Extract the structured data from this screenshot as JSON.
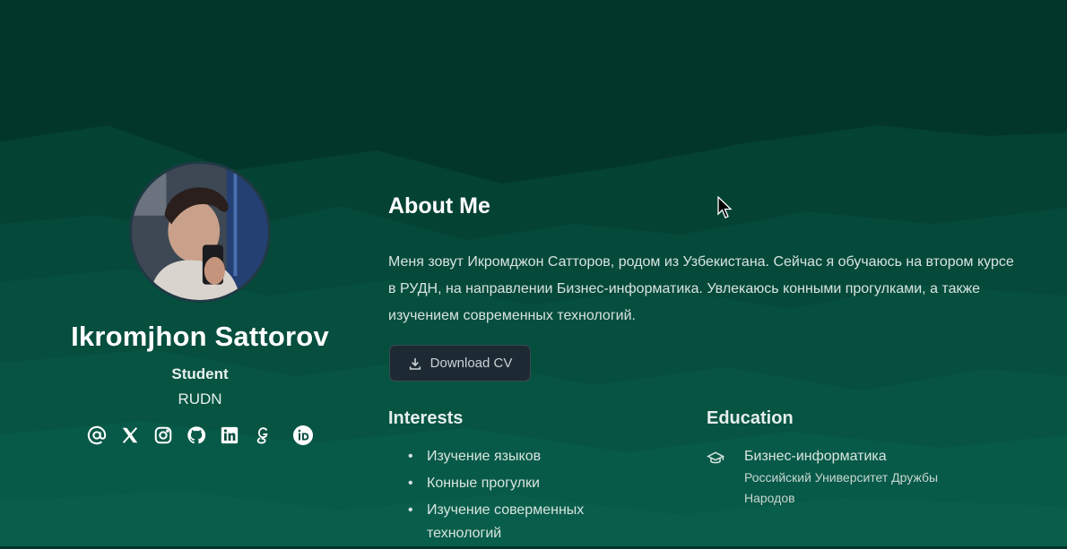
{
  "colors": {
    "bg_dark": "#02362b",
    "bg_mid": "#064a3b",
    "bg_light": "#0b5b49",
    "button_bg": "#1e2a33"
  },
  "profile": {
    "name": "Ikromjhon Sattorov",
    "role": "Student",
    "organization": "RUDN",
    "socials": [
      {
        "icon": "at-sign-icon"
      },
      {
        "icon": "x-twitter-icon"
      },
      {
        "icon": "instagram-icon"
      },
      {
        "icon": "github-icon"
      },
      {
        "icon": "linkedin-icon"
      },
      {
        "icon": "google-scholar-icon"
      },
      {
        "icon": "orcid-icon"
      }
    ]
  },
  "about": {
    "title": "About Me",
    "bio": "Меня зовут Икромджон Сатторов, родом из Узбекистана. Сейчас я обучаюсь на втором курсе в РУДН, на направлении Бизнес-информатика. Увлекаюсь конными прогулками, а также изучением современных технологий.",
    "download_label": "Download CV"
  },
  "interests": {
    "title": "Interests",
    "items": [
      "Изучение языков",
      "Конные прогулки",
      "Изучение соверменных технологий"
    ]
  },
  "education": {
    "title": "Education",
    "degree": "Бизнес-информатика",
    "school": "Российский Университет Дружбы Народов"
  }
}
